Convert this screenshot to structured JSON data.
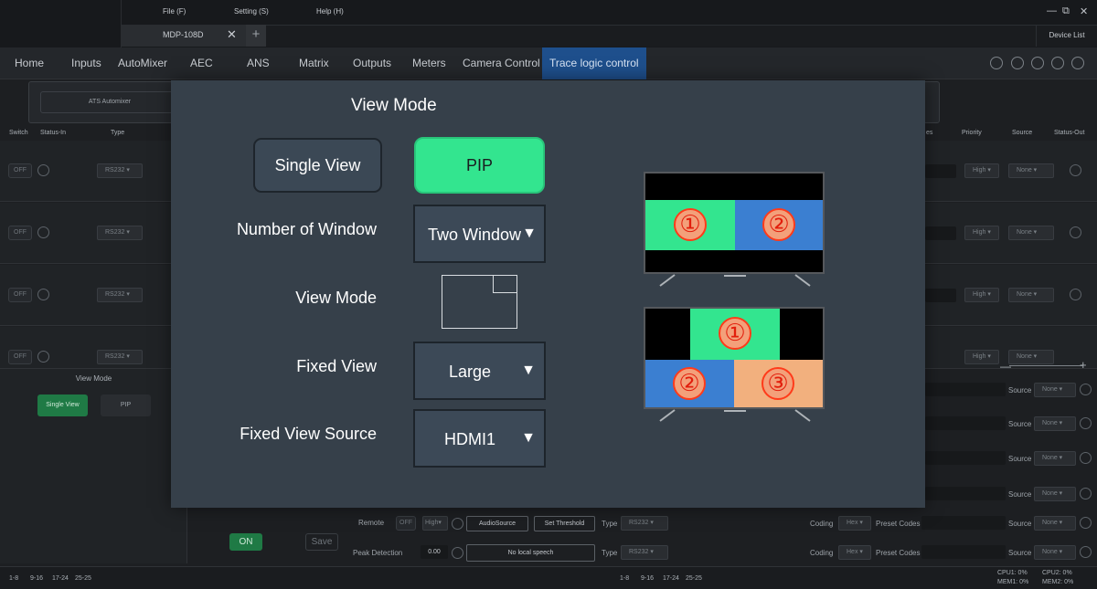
{
  "menu": {
    "file": "File (F)",
    "setting": "Setting (S)",
    "help": "Help (H)"
  },
  "window_controls": {
    "minimize": "—",
    "restore": "⧉",
    "close": "✕"
  },
  "tabs": {
    "document": "MDP-108D",
    "close": "✕",
    "add": "+",
    "device_list": "Device List"
  },
  "nav": {
    "items": [
      "Home",
      "Inputs",
      "AutoMixer",
      "AEC",
      "ANS",
      "Matrix",
      "Outputs",
      "Meters",
      "Camera Control",
      "Trace logic control"
    ],
    "active_index": 9
  },
  "background": {
    "ats_button": "ATS Automixer",
    "headers": {
      "switch": "Switch",
      "status_in": "Status-In",
      "type": "Type",
      "es": "es",
      "priority": "Priority",
      "source": "Source",
      "status_out": "Status-Out"
    },
    "row_switch": "OFF",
    "row_type": "RS232",
    "row_priority": "High",
    "row_source": "None",
    "view_mode_title": "View Mode",
    "single_view": "Single View",
    "pip": "PIP",
    "on_button": "ON",
    "save_button": "Save",
    "remote_label": "Remote",
    "remote_switch": "OFF",
    "remote_priority": "High",
    "audio_source_button": "AudioSource",
    "set_threshold_button": "Set Threshold",
    "type_label": "Type",
    "type_value": "RS232",
    "peak_detection_label": "Peak Detection",
    "peak_value": "0.00",
    "no_local_speech": "No local speech",
    "coding_label": "Coding",
    "coding_value": "Hex",
    "preset_codes_label": "Preset Codes",
    "source_label": "Source",
    "source_value": "None",
    "zoom_minus": "—",
    "zoom_plus": "+"
  },
  "status": {
    "left_pages": [
      "1-8",
      "9-16",
      "17-24",
      "25-25"
    ],
    "mid_pages": [
      "1-8",
      "9-16",
      "17-24",
      "25-25"
    ],
    "cpu1": "CPU1:  0%",
    "cpu2": "CPU2:  0%",
    "mem1": "MEM1:  0%",
    "mem2": "MEM2:  0%"
  },
  "modal": {
    "title": "View Mode",
    "single_view": "Single View",
    "pip": "PIP",
    "number_of_window_label": "Number of Window",
    "number_of_window_value": "Two Window",
    "view_mode_label": "View Mode",
    "fixed_view_label": "Fixed View",
    "fixed_view_value": "Large",
    "fixed_view_source_label": "Fixed View Source",
    "fixed_view_source_value": "HDMI1",
    "dropdown_arrow": "▼",
    "tv1_numbers": [
      "①",
      "②"
    ],
    "tv2_numbers": [
      "①",
      "②",
      "③"
    ],
    "colors": {
      "pip_active": "#33e58f",
      "green": "#33e58f",
      "blue": "#3b7fd1",
      "peach": "#f2b07e",
      "accent_nav": "#1e4f8c"
    }
  }
}
